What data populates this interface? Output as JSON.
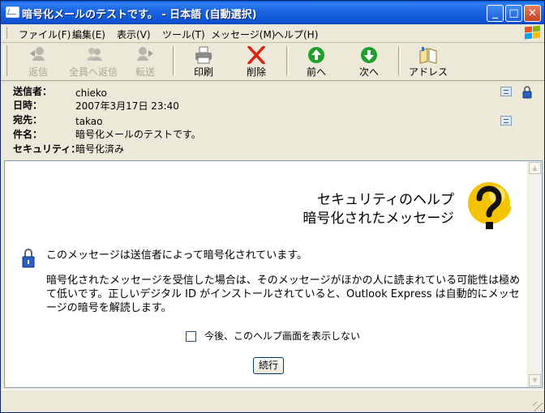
{
  "window": {
    "title": "暗号化メールのテストです。 - 日本語 (自動選択)",
    "controls": {
      "minimize": "_",
      "maximize": "□",
      "close": "✕"
    }
  },
  "menu": [
    {
      "label": "ファイル(F)"
    },
    {
      "label": "編集(E)"
    },
    {
      "label": "表示(V)"
    },
    {
      "label": "ツール(T)"
    },
    {
      "label": "メッセージ(M)"
    },
    {
      "label": "ヘルプ(H)"
    }
  ],
  "toolbar": {
    "reply": {
      "label": "返信",
      "icon": "reply-icon",
      "enabled": false
    },
    "reply_all": {
      "label": "全員へ返信",
      "icon": "reply-all-icon",
      "enabled": false
    },
    "forward": {
      "label": "転送",
      "icon": "forward-icon",
      "enabled": false
    },
    "print": {
      "label": "印刷",
      "icon": "printer-icon",
      "enabled": true
    },
    "delete": {
      "label": "削除",
      "icon": "delete-x-icon",
      "enabled": true
    },
    "previous": {
      "label": "前へ",
      "icon": "up-arrow-icon",
      "enabled": true
    },
    "next": {
      "label": "次へ",
      "icon": "down-arrow-icon",
      "enabled": true
    },
    "addresses": {
      "label": "アドレス",
      "icon": "address-book-icon",
      "enabled": true
    }
  },
  "headers": {
    "from": {
      "label": "送信者：",
      "value": "chieko"
    },
    "date": {
      "label": "日時：",
      "value": "2007年3月17日 23:40"
    },
    "to": {
      "label": "宛先：",
      "value": "takao"
    },
    "subject": {
      "label": "件名：",
      "value": "暗号化メールのテストです。"
    },
    "security": {
      "label": "セキュリティ：",
      "value": "暗号化済み"
    }
  },
  "help": {
    "title_line1": "セキュリティのヘルプ",
    "title_line2": "暗号化されたメッセージ",
    "intro": "このメッセージは送信者によって暗号化されています。",
    "body": "暗号化されたメッセージを受信した場合は、そのメッセージがほかの人に読まれている可能性は極めて低いです。正しいデジタル ID がインストールされていると、Outlook Express は自動的にメッセージの暗号を解読します。",
    "checkbox_label": "今後、このヘルプ画面を表示しない",
    "checkbox_checked": false,
    "continue_label": "続行"
  },
  "colors": {
    "title_bar": "#0a5fd8",
    "window_bg": "#ece9d8",
    "delete_red": "#e02010",
    "arrow_green": "#1fa02a",
    "help_logo_yellow": "#f5c400"
  }
}
